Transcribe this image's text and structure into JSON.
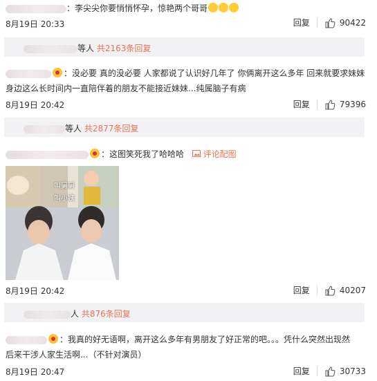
{
  "comments": [
    {
      "username": "",
      "text": "：李尖尖你要悄悄怀孕，惊艳两个哥哥",
      "emojis": [
        "crying-laugh-emoji",
        "crying-laugh-emoji",
        "crying-laugh-emoji"
      ],
      "time": "8月19日 20:33",
      "reply_label": "回复",
      "likes": "90422",
      "replies": {
        "prefix": "等人",
        "count": "共2163条回复"
      }
    },
    {
      "username": "",
      "text_line1": "：没必要 真的没必要 人家都说了认识好几年了 你俩离开这么多年 回来就要求妹妹",
      "text_line2": "身边这么长时间内一直陪伴着的朋友不能接近妹妹...纯属脑子有病",
      "time": "8月19日 20:42",
      "reply_label": "回复",
      "likes": "79396",
      "replies": {
        "prefix": "等人",
        "count": "共2877条回复"
      }
    },
    {
      "username": "",
      "text": "：这图笑死我了哈哈哈",
      "pic_link": "评论配图",
      "image_caption_1": "叫舅舅",
      "image_caption_2": "叫小姨",
      "time": "8月19日 20:42",
      "reply_label": "回复",
      "likes": "40207",
      "replies": {
        "prefix": "人",
        "count": "共876条回复"
      }
    },
    {
      "username": "",
      "text_line1": "：我真的好无语啊，离开这么多年有男朋友了好正常的吧。。。凭什么突然出现然",
      "text_line2": "后来干涉人家生活啊...（不针对演员）",
      "time": "8月19日 20:47",
      "reply_label": "回复",
      "likes": "30733"
    }
  ],
  "colors": {
    "accent": "#eb7350",
    "reply_bg": "#f2f2f5"
  }
}
